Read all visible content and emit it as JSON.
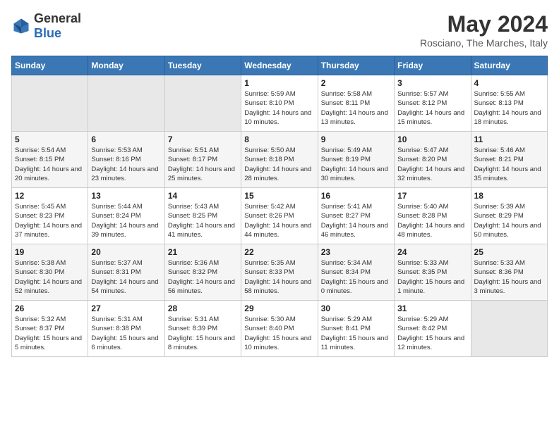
{
  "header": {
    "logo_general": "General",
    "logo_blue": "Blue",
    "month_title": "May 2024",
    "subtitle": "Rosciano, The Marches, Italy"
  },
  "days_of_week": [
    "Sunday",
    "Monday",
    "Tuesday",
    "Wednesday",
    "Thursday",
    "Friday",
    "Saturday"
  ],
  "weeks": [
    [
      {
        "day": "",
        "sunrise": "",
        "sunset": "",
        "daylight": ""
      },
      {
        "day": "",
        "sunrise": "",
        "sunset": "",
        "daylight": ""
      },
      {
        "day": "",
        "sunrise": "",
        "sunset": "",
        "daylight": ""
      },
      {
        "day": "1",
        "sunrise": "Sunrise: 5:59 AM",
        "sunset": "Sunset: 8:10 PM",
        "daylight": "Daylight: 14 hours and 10 minutes."
      },
      {
        "day": "2",
        "sunrise": "Sunrise: 5:58 AM",
        "sunset": "Sunset: 8:11 PM",
        "daylight": "Daylight: 14 hours and 13 minutes."
      },
      {
        "day": "3",
        "sunrise": "Sunrise: 5:57 AM",
        "sunset": "Sunset: 8:12 PM",
        "daylight": "Daylight: 14 hours and 15 minutes."
      },
      {
        "day": "4",
        "sunrise": "Sunrise: 5:55 AM",
        "sunset": "Sunset: 8:13 PM",
        "daylight": "Daylight: 14 hours and 18 minutes."
      }
    ],
    [
      {
        "day": "5",
        "sunrise": "Sunrise: 5:54 AM",
        "sunset": "Sunset: 8:15 PM",
        "daylight": "Daylight: 14 hours and 20 minutes."
      },
      {
        "day": "6",
        "sunrise": "Sunrise: 5:53 AM",
        "sunset": "Sunset: 8:16 PM",
        "daylight": "Daylight: 14 hours and 23 minutes."
      },
      {
        "day": "7",
        "sunrise": "Sunrise: 5:51 AM",
        "sunset": "Sunset: 8:17 PM",
        "daylight": "Daylight: 14 hours and 25 minutes."
      },
      {
        "day": "8",
        "sunrise": "Sunrise: 5:50 AM",
        "sunset": "Sunset: 8:18 PM",
        "daylight": "Daylight: 14 hours and 28 minutes."
      },
      {
        "day": "9",
        "sunrise": "Sunrise: 5:49 AM",
        "sunset": "Sunset: 8:19 PM",
        "daylight": "Daylight: 14 hours and 30 minutes."
      },
      {
        "day": "10",
        "sunrise": "Sunrise: 5:47 AM",
        "sunset": "Sunset: 8:20 PM",
        "daylight": "Daylight: 14 hours and 32 minutes."
      },
      {
        "day": "11",
        "sunrise": "Sunrise: 5:46 AM",
        "sunset": "Sunset: 8:21 PM",
        "daylight": "Daylight: 14 hours and 35 minutes."
      }
    ],
    [
      {
        "day": "12",
        "sunrise": "Sunrise: 5:45 AM",
        "sunset": "Sunset: 8:23 PM",
        "daylight": "Daylight: 14 hours and 37 minutes."
      },
      {
        "day": "13",
        "sunrise": "Sunrise: 5:44 AM",
        "sunset": "Sunset: 8:24 PM",
        "daylight": "Daylight: 14 hours and 39 minutes."
      },
      {
        "day": "14",
        "sunrise": "Sunrise: 5:43 AM",
        "sunset": "Sunset: 8:25 PM",
        "daylight": "Daylight: 14 hours and 41 minutes."
      },
      {
        "day": "15",
        "sunrise": "Sunrise: 5:42 AM",
        "sunset": "Sunset: 8:26 PM",
        "daylight": "Daylight: 14 hours and 44 minutes."
      },
      {
        "day": "16",
        "sunrise": "Sunrise: 5:41 AM",
        "sunset": "Sunset: 8:27 PM",
        "daylight": "Daylight: 14 hours and 46 minutes."
      },
      {
        "day": "17",
        "sunrise": "Sunrise: 5:40 AM",
        "sunset": "Sunset: 8:28 PM",
        "daylight": "Daylight: 14 hours and 48 minutes."
      },
      {
        "day": "18",
        "sunrise": "Sunrise: 5:39 AM",
        "sunset": "Sunset: 8:29 PM",
        "daylight": "Daylight: 14 hours and 50 minutes."
      }
    ],
    [
      {
        "day": "19",
        "sunrise": "Sunrise: 5:38 AM",
        "sunset": "Sunset: 8:30 PM",
        "daylight": "Daylight: 14 hours and 52 minutes."
      },
      {
        "day": "20",
        "sunrise": "Sunrise: 5:37 AM",
        "sunset": "Sunset: 8:31 PM",
        "daylight": "Daylight: 14 hours and 54 minutes."
      },
      {
        "day": "21",
        "sunrise": "Sunrise: 5:36 AM",
        "sunset": "Sunset: 8:32 PM",
        "daylight": "Daylight: 14 hours and 56 minutes."
      },
      {
        "day": "22",
        "sunrise": "Sunrise: 5:35 AM",
        "sunset": "Sunset: 8:33 PM",
        "daylight": "Daylight: 14 hours and 58 minutes."
      },
      {
        "day": "23",
        "sunrise": "Sunrise: 5:34 AM",
        "sunset": "Sunset: 8:34 PM",
        "daylight": "Daylight: 15 hours and 0 minutes."
      },
      {
        "day": "24",
        "sunrise": "Sunrise: 5:33 AM",
        "sunset": "Sunset: 8:35 PM",
        "daylight": "Daylight: 15 hours and 1 minute."
      },
      {
        "day": "25",
        "sunrise": "Sunrise: 5:33 AM",
        "sunset": "Sunset: 8:36 PM",
        "daylight": "Daylight: 15 hours and 3 minutes."
      }
    ],
    [
      {
        "day": "26",
        "sunrise": "Sunrise: 5:32 AM",
        "sunset": "Sunset: 8:37 PM",
        "daylight": "Daylight: 15 hours and 5 minutes."
      },
      {
        "day": "27",
        "sunrise": "Sunrise: 5:31 AM",
        "sunset": "Sunset: 8:38 PM",
        "daylight": "Daylight: 15 hours and 6 minutes."
      },
      {
        "day": "28",
        "sunrise": "Sunrise: 5:31 AM",
        "sunset": "Sunset: 8:39 PM",
        "daylight": "Daylight: 15 hours and 8 minutes."
      },
      {
        "day": "29",
        "sunrise": "Sunrise: 5:30 AM",
        "sunset": "Sunset: 8:40 PM",
        "daylight": "Daylight: 15 hours and 10 minutes."
      },
      {
        "day": "30",
        "sunrise": "Sunrise: 5:29 AM",
        "sunset": "Sunset: 8:41 PM",
        "daylight": "Daylight: 15 hours and 11 minutes."
      },
      {
        "day": "31",
        "sunrise": "Sunrise: 5:29 AM",
        "sunset": "Sunset: 8:42 PM",
        "daylight": "Daylight: 15 hours and 12 minutes."
      },
      {
        "day": "",
        "sunrise": "",
        "sunset": "",
        "daylight": ""
      }
    ]
  ]
}
